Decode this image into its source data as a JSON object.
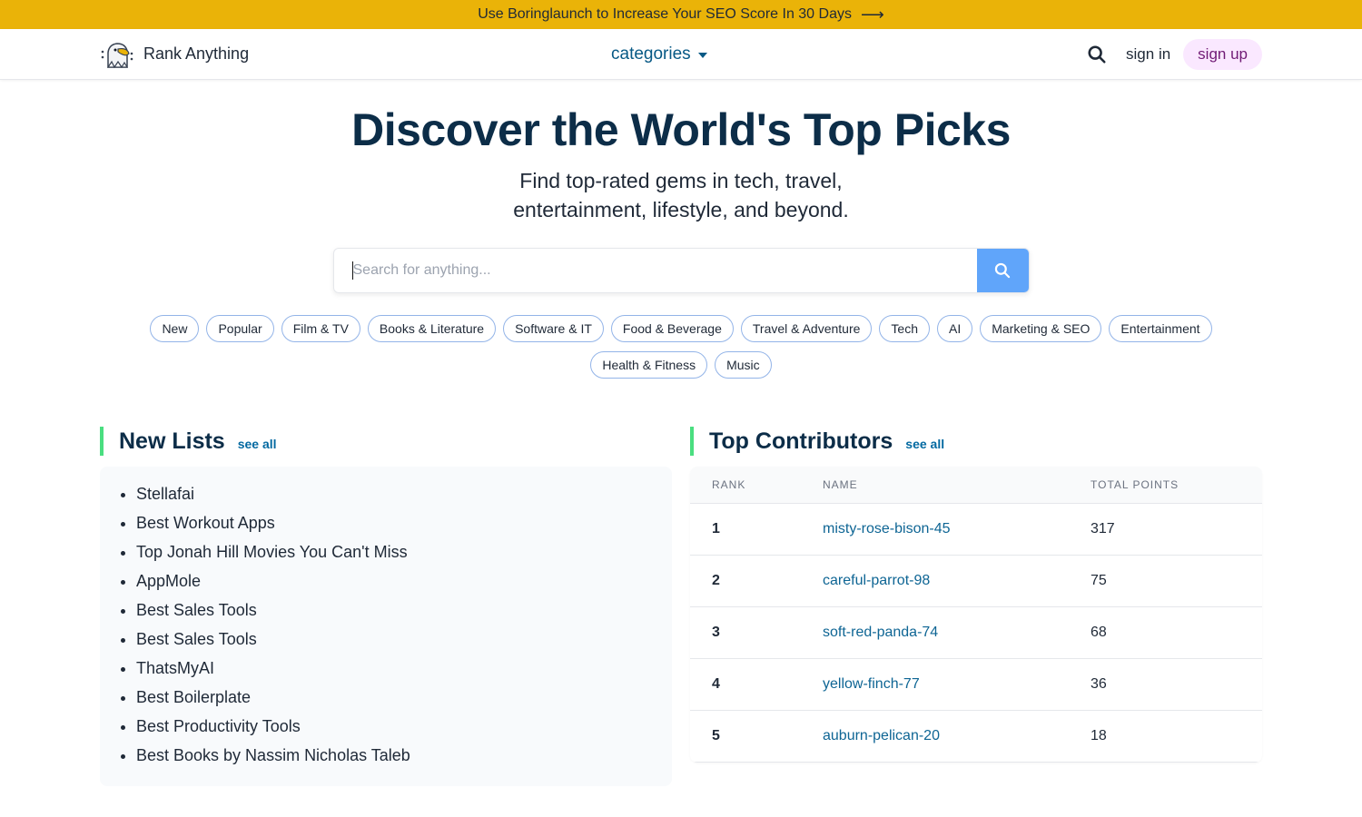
{
  "promo": {
    "text": "Use Boringlaunch to Increase Your SEO Score In 30 Days",
    "arrow": "⟶"
  },
  "nav": {
    "brand": "Rank Anything",
    "categories_label": "categories",
    "sign_in": "sign in",
    "sign_up": "sign up"
  },
  "hero": {
    "title": "Discover the World's Top Picks",
    "subtitle_line1": "Find top-rated gems in tech, travel,",
    "subtitle_line2": "entertainment, lifestyle, and beyond."
  },
  "search": {
    "placeholder": "Search for anything...",
    "value": ""
  },
  "chips": [
    "New",
    "Popular",
    "Film & TV",
    "Books & Literature",
    "Software & IT",
    "Food & Beverage",
    "Travel & Adventure",
    "Tech",
    "AI",
    "Marketing & SEO",
    "Entertainment",
    "Health & Fitness",
    "Music"
  ],
  "new_lists": {
    "title": "New Lists",
    "see_all": "see all",
    "items": [
      "Stellafai",
      "Best Workout Apps",
      "Top Jonah Hill Movies You Can't Miss",
      "AppMole",
      "Best Sales Tools",
      "Best Sales Tools",
      "ThatsMyAI",
      "Best Boilerplate",
      "Best Productivity Tools",
      "Best Books by Nassim Nicholas Taleb"
    ]
  },
  "top_contributors": {
    "title": "Top Contributors",
    "see_all": "see all",
    "columns": [
      "RANK",
      "NAME",
      "TOTAL POINTS"
    ],
    "rows": [
      {
        "rank": "1",
        "name": "misty-rose-bison-45",
        "points": "317"
      },
      {
        "rank": "2",
        "name": "careful-parrot-98",
        "points": "75"
      },
      {
        "rank": "3",
        "name": "soft-red-panda-74",
        "points": "68"
      },
      {
        "rank": "4",
        "name": "yellow-finch-77",
        "points": "36"
      },
      {
        "rank": "5",
        "name": "auburn-pelican-20",
        "points": "18"
      }
    ]
  },
  "colors": {
    "promo_bg": "#eab308",
    "heading": "#0c2d48",
    "link": "#0369a1",
    "accent_bar": "#4ade80",
    "search_button": "#60a5fa",
    "signup_bg": "#fae8ff"
  }
}
